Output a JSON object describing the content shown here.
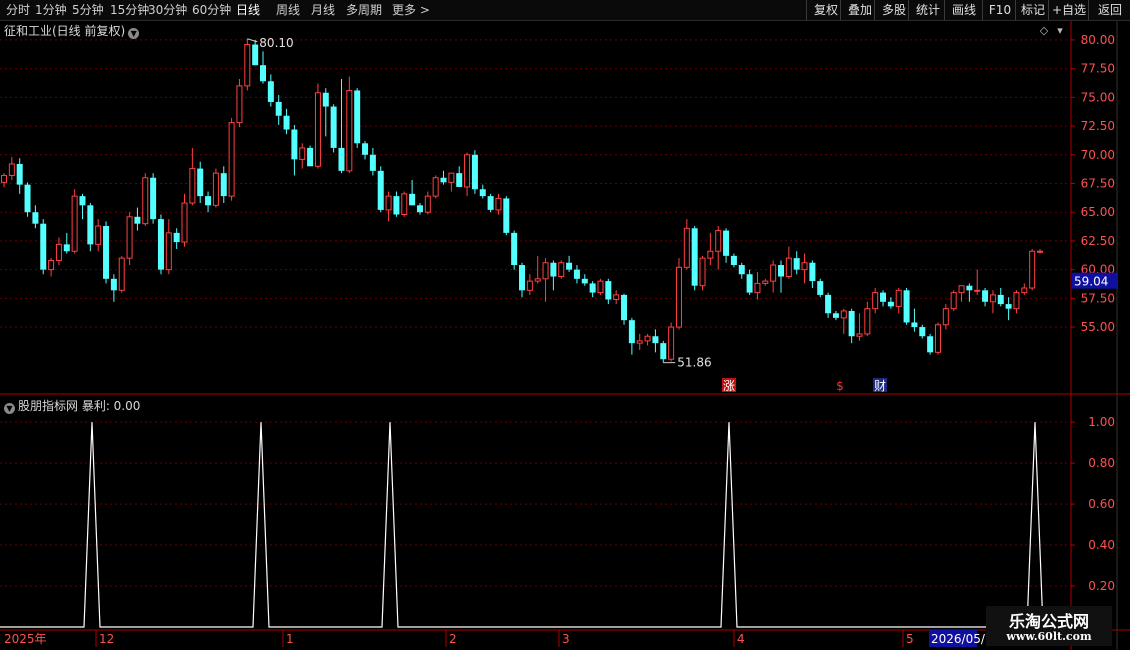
{
  "toolbar": {
    "periods": [
      {
        "label": "分时",
        "active": false
      },
      {
        "label": "1分钟",
        "active": false
      },
      {
        "label": "5分钟",
        "active": false
      },
      {
        "label": "15分钟",
        "active": false
      },
      {
        "label": "30分钟",
        "active": false
      },
      {
        "label": "60分钟",
        "active": false
      },
      {
        "label": "日线",
        "active": true
      },
      {
        "label": "周线",
        "active": false
      },
      {
        "label": "月线",
        "active": false
      },
      {
        "label": "多周期",
        "active": false
      },
      {
        "label": "更多 >",
        "active": false
      }
    ],
    "right_buttons": [
      "复权",
      "叠加",
      "多股",
      "统计",
      "画线",
      "F10",
      "标记",
      "+自选",
      "返回"
    ]
  },
  "stock": {
    "title": "征和工业(日线 前复权)",
    "high_label": "80.10",
    "low_label": "51.86",
    "current_price": "59.04",
    "event_markers": [
      "涨",
      "$",
      "财"
    ]
  },
  "indicator": {
    "title": "股朋指标网 暴利: 0.00"
  },
  "watermark": {
    "title": "乐淘公式网",
    "url": "www.60lt.com"
  },
  "colors": {
    "up": "#ff4040",
    "down": "#54ffff",
    "axis": "#b00000",
    "text_axis": "#ff5050",
    "indicator_line": "#ffffff",
    "price_box": "#1010a0"
  },
  "chart_data": [
    {
      "type": "candlestick",
      "y_ticks": [
        55.0,
        57.5,
        60.0,
        62.5,
        65.0,
        67.5,
        70.0,
        72.5,
        75.0,
        77.5,
        80.0
      ],
      "ylim": [
        51.0,
        81.3
      ],
      "x_tick_labels": [
        "2025年",
        "12",
        "1",
        "2",
        "3",
        "4",
        "5",
        "2026/05/"
      ],
      "x_tick_index": [
        0,
        14,
        40,
        63,
        79,
        104,
        128,
        135
      ],
      "candles": [
        [
          67.6,
          68.4,
          67.2,
          68.2
        ],
        [
          68.2,
          69.8,
          67.8,
          69.2
        ],
        [
          69.2,
          69.7,
          66.6,
          67.4
        ],
        [
          67.4,
          67.6,
          64.6,
          65.0
        ],
        [
          65.0,
          65.6,
          63.6,
          64.0
        ],
        [
          64.0,
          64.4,
          59.6,
          60.0
        ],
        [
          60.0,
          61.0,
          59.4,
          60.8
        ],
        [
          60.8,
          62.8,
          60.4,
          62.2
        ],
        [
          62.2,
          63.2,
          61.4,
          61.6
        ],
        [
          61.6,
          67.0,
          61.4,
          66.4
        ],
        [
          66.4,
          66.6,
          64.4,
          65.6
        ],
        [
          65.6,
          65.8,
          61.6,
          62.2
        ],
        [
          62.2,
          64.4,
          61.6,
          63.8
        ],
        [
          63.8,
          64.2,
          58.8,
          59.2
        ],
        [
          59.2,
          59.6,
          57.2,
          58.2
        ],
        [
          58.2,
          61.2,
          58.0,
          61.0
        ],
        [
          61.0,
          65.0,
          60.4,
          64.6
        ],
        [
          64.6,
          65.4,
          63.4,
          64.0
        ],
        [
          64.0,
          68.4,
          63.8,
          68.0
        ],
        [
          68.0,
          68.4,
          64.0,
          64.4
        ],
        [
          64.4,
          64.8,
          59.6,
          60.0
        ],
        [
          60.0,
          64.4,
          59.6,
          63.2
        ],
        [
          63.2,
          63.6,
          61.8,
          62.4
        ],
        [
          62.4,
          66.6,
          62.0,
          65.8
        ],
        [
          65.8,
          70.6,
          65.6,
          68.8
        ],
        [
          68.8,
          69.4,
          65.8,
          66.4
        ],
        [
          66.4,
          66.8,
          65.0,
          65.6
        ],
        [
          65.6,
          68.8,
          65.4,
          68.4
        ],
        [
          68.4,
          69.0,
          65.8,
          66.4
        ],
        [
          66.4,
          73.2,
          66.0,
          72.8
        ],
        [
          72.8,
          76.6,
          72.4,
          76.0
        ],
        [
          76.0,
          80.1,
          75.6,
          79.6
        ],
        [
          79.6,
          80.0,
          77.8,
          77.8
        ],
        [
          77.8,
          79.0,
          76.2,
          76.4
        ],
        [
          76.4,
          77.0,
          74.2,
          74.6
        ],
        [
          74.6,
          75.2,
          72.6,
          73.4
        ],
        [
          73.4,
          74.0,
          71.8,
          72.2
        ],
        [
          72.2,
          72.6,
          68.2,
          69.6
        ],
        [
          69.6,
          71.0,
          68.8,
          70.6
        ],
        [
          70.6,
          70.8,
          69.0,
          69.0
        ],
        [
          69.0,
          76.2,
          68.8,
          75.4
        ],
        [
          75.4,
          75.8,
          71.6,
          74.2
        ],
        [
          74.2,
          74.4,
          70.2,
          70.6
        ],
        [
          70.6,
          76.6,
          68.4,
          68.6
        ],
        [
          68.6,
          76.8,
          68.4,
          75.6
        ],
        [
          75.6,
          75.8,
          70.6,
          71.0
        ],
        [
          71.0,
          71.2,
          69.6,
          70.0
        ],
        [
          70.0,
          70.6,
          68.2,
          68.6
        ],
        [
          68.6,
          69.0,
          65.0,
          65.2
        ],
        [
          65.2,
          66.8,
          64.2,
          66.4
        ],
        [
          66.4,
          66.8,
          64.6,
          64.8
        ],
        [
          64.8,
          66.8,
          64.6,
          66.6
        ],
        [
          66.6,
          67.8,
          65.6,
          65.6
        ],
        [
          65.6,
          65.8,
          64.8,
          65.0
        ],
        [
          65.0,
          66.8,
          64.8,
          66.4
        ],
        [
          66.4,
          68.2,
          66.2,
          68.0
        ],
        [
          68.0,
          68.6,
          67.4,
          67.6
        ],
        [
          67.6,
          68.4,
          66.8,
          68.4
        ],
        [
          68.4,
          69.0,
          67.2,
          67.2
        ],
        [
          67.2,
          70.2,
          66.4,
          70.0
        ],
        [
          70.0,
          70.4,
          66.6,
          67.0
        ],
        [
          67.0,
          67.4,
          66.2,
          66.4
        ],
        [
          66.4,
          66.6,
          65.0,
          65.2
        ],
        [
          65.2,
          66.6,
          64.8,
          66.2
        ],
        [
          66.2,
          66.4,
          63.0,
          63.2
        ],
        [
          63.2,
          63.4,
          60.0,
          60.4
        ],
        [
          60.4,
          60.6,
          57.6,
          58.2
        ],
        [
          58.2,
          59.6,
          57.8,
          59.0
        ],
        [
          59.0,
          61.2,
          58.8,
          59.2
        ],
        [
          59.2,
          61.0,
          57.2,
          60.6
        ],
        [
          60.6,
          60.8,
          58.2,
          59.4
        ],
        [
          59.4,
          60.8,
          59.2,
          60.6
        ],
        [
          60.6,
          61.2,
          59.8,
          60.0
        ],
        [
          60.0,
          60.4,
          58.8,
          59.2
        ],
        [
          59.2,
          59.6,
          58.6,
          58.8
        ],
        [
          58.8,
          59.0,
          57.6,
          58.0
        ],
        [
          58.0,
          59.2,
          57.8,
          59.0
        ],
        [
          59.0,
          59.2,
          57.0,
          57.4
        ],
        [
          57.4,
          58.2,
          57.0,
          57.8
        ],
        [
          57.8,
          57.9,
          55.2,
          55.6
        ],
        [
          55.6,
          55.8,
          52.6,
          53.6
        ],
        [
          53.6,
          54.4,
          53.0,
          53.8
        ],
        [
          53.8,
          54.4,
          53.4,
          54.2
        ],
        [
          54.2,
          54.8,
          52.8,
          53.6
        ],
        [
          53.6,
          53.8,
          51.9,
          52.2
        ],
        [
          52.2,
          55.4,
          52.0,
          55.0
        ],
        [
          55.0,
          61.0,
          54.8,
          60.2
        ],
        [
          60.2,
          64.4,
          60.0,
          63.6
        ],
        [
          63.6,
          63.8,
          58.2,
          58.6
        ],
        [
          58.6,
          61.2,
          58.2,
          61.0
        ],
        [
          61.0,
          63.2,
          60.4,
          61.6
        ],
        [
          61.6,
          63.8,
          60.0,
          63.4
        ],
        [
          63.4,
          63.6,
          60.6,
          61.2
        ],
        [
          61.2,
          61.4,
          60.2,
          60.4
        ],
        [
          60.4,
          60.6,
          59.2,
          59.6
        ],
        [
          59.6,
          60.0,
          57.8,
          58.0
        ],
        [
          58.0,
          59.8,
          57.4,
          58.8
        ],
        [
          58.8,
          59.2,
          58.6,
          59.0
        ],
        [
          59.0,
          60.8,
          58.0,
          60.4
        ],
        [
          60.4,
          60.8,
          58.0,
          59.4
        ],
        [
          59.4,
          62.0,
          59.2,
          61.0
        ],
        [
          61.0,
          61.6,
          59.6,
          60.0
        ],
        [
          60.0,
          61.4,
          58.8,
          60.6
        ],
        [
          60.6,
          60.8,
          58.4,
          59.0
        ],
        [
          59.0,
          59.2,
          57.6,
          57.8
        ],
        [
          57.8,
          58.0,
          55.8,
          56.2
        ],
        [
          56.2,
          56.4,
          55.6,
          55.8
        ],
        [
          55.8,
          56.6,
          54.4,
          56.4
        ],
        [
          56.4,
          56.6,
          53.6,
          54.2
        ],
        [
          54.2,
          56.2,
          53.8,
          54.4
        ],
        [
          54.4,
          57.2,
          54.2,
          56.6
        ],
        [
          56.6,
          58.4,
          56.2,
          58.0
        ],
        [
          58.0,
          58.2,
          56.8,
          57.2
        ],
        [
          57.2,
          57.6,
          56.6,
          56.8
        ],
        [
          56.8,
          58.4,
          56.2,
          58.2
        ],
        [
          58.2,
          58.4,
          55.2,
          55.4
        ],
        [
          55.4,
          56.6,
          54.6,
          55.0
        ],
        [
          55.0,
          55.2,
          54.0,
          54.2
        ],
        [
          54.2,
          54.4,
          52.6,
          52.8
        ],
        [
          52.8,
          55.4,
          52.6,
          55.2
        ],
        [
          55.2,
          57.0,
          54.8,
          56.6
        ],
        [
          56.6,
          58.2,
          56.4,
          58.0
        ],
        [
          58.0,
          58.6,
          57.2,
          58.6
        ],
        [
          58.6,
          58.8,
          57.2,
          58.2
        ],
        [
          58.2,
          60.0,
          57.8,
          58.2
        ],
        [
          58.2,
          58.4,
          56.8,
          57.2
        ],
        [
          57.2,
          58.2,
          56.2,
          57.8
        ],
        [
          57.8,
          58.4,
          56.8,
          57.0
        ],
        [
          57.0,
          57.6,
          55.6,
          56.6
        ],
        [
          56.6,
          58.2,
          56.2,
          58.0
        ],
        [
          58.0,
          58.8,
          57.8,
          58.4
        ],
        [
          58.4,
          61.8,
          58.2,
          61.6
        ],
        [
          61.6,
          61.8,
          61.4,
          61.6
        ]
      ]
    },
    {
      "type": "line",
      "series": [
        {
          "name": "暴利",
          "x": [
            0,
            1,
            2,
            3,
            4,
            5,
            6,
            7,
            8,
            9,
            10
          ],
          "values": [
            0,
            1,
            0,
            1,
            0,
            1,
            0,
            1,
            0,
            1,
            0
          ]
        }
      ],
      "y_ticks": [
        0.2,
        0.4,
        0.6,
        0.8,
        1.0
      ],
      "ylim": [
        0,
        1.03
      ]
    }
  ]
}
